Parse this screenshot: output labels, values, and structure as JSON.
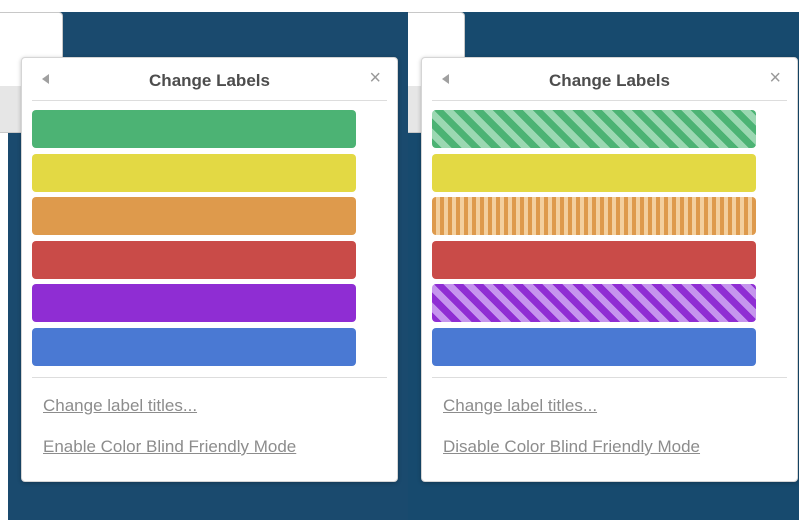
{
  "colors": {
    "board_background": "#1a4a6e",
    "green": "#4cb374",
    "green_stripe": "#9bd8b2",
    "yellow": "#e3d944",
    "orange": "#de9a4c",
    "orange_stripe": "#f3cf9e",
    "red": "#c94b48",
    "purple": "#8f2dd3",
    "purple_stripe": "#c695ee",
    "blue": "#4a79d3"
  },
  "left_popover": {
    "title": "Change Labels",
    "back_icon": "back-arrow-icon",
    "close_icon": "close-icon",
    "close_glyph": "×",
    "labels": [
      "green",
      "yellow",
      "orange",
      "red",
      "purple",
      "blue"
    ],
    "patterned": false,
    "link_titles": "Change label titles...",
    "link_mode": "Enable Color Blind Friendly Mode"
  },
  "right_popover": {
    "title": "Change Labels",
    "back_icon": "back-arrow-icon",
    "close_icon": "close-icon",
    "close_glyph": "×",
    "labels": [
      "green",
      "yellow",
      "orange",
      "red",
      "purple",
      "blue"
    ],
    "patterned": true,
    "link_titles": "Change label titles...",
    "link_mode": "Disable Color Blind Friendly Mode"
  }
}
